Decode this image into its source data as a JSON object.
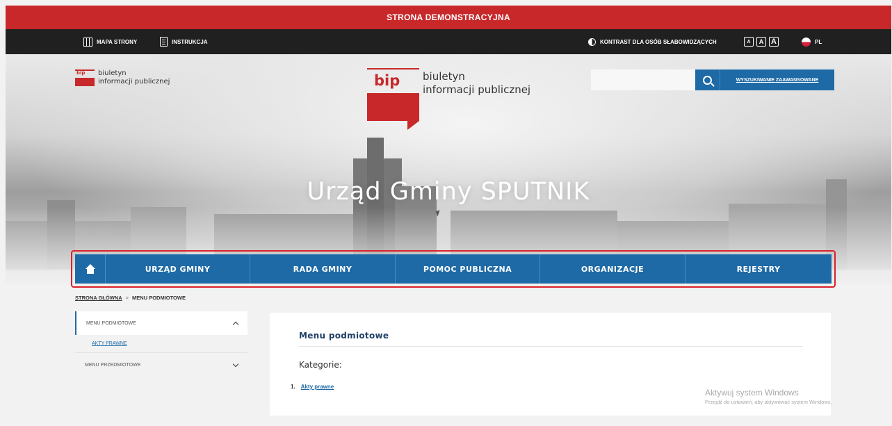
{
  "demo_banner": "STRONA DEMONSTRACYJNA",
  "topbar": {
    "sitemap": "MAPA STRONY",
    "instructions": "INSTRUKCJA",
    "contrast": "KONTRAST DLA OSÓB SŁABOWIDZĄCYCH",
    "font_sizes": [
      "A",
      "A",
      "A"
    ],
    "language": "PL"
  },
  "header": {
    "small_logo_badge": "bip",
    "small_logo_line1": "biuletyn",
    "small_logo_line2": "informacji publicznej",
    "center_logo_badge": "bip",
    "center_logo_line1": "biuletyn",
    "center_logo_line2": "informacji publicznej",
    "search_placeholder": "",
    "advanced_search": "WYSZUKIWANIE ZAAWANSOWANE",
    "hero_title": "Urząd Gminy SPUTNIK"
  },
  "nav": {
    "items": [
      "URZĄD GMINY",
      "RADA GMINY",
      "POMOC PUBLICZNA",
      "ORGANIZACJE",
      "REJESTRY"
    ]
  },
  "breadcrumb": {
    "home": "STRONA GŁÓWNA",
    "separator": ">",
    "current": "MENU PODMIOTOWE"
  },
  "sidebar": {
    "section1": "MENU PODMIOTOWE",
    "section1_sub": "AKTY PRAWNE",
    "section2": "MENU PRZEDMIOTOWE"
  },
  "content": {
    "title": "Menu podmiotowe",
    "categories_label": "Kategorie:",
    "items": [
      {
        "num": "1.",
        "label": "Akty prawne"
      }
    ]
  },
  "watermark": {
    "line1": "Aktywuj system Windows",
    "line2": "Przejdź do ustawień, aby aktywować system Windows."
  },
  "colors": {
    "brand_red": "#c8282a",
    "nav_blue": "#1e6aa6",
    "top_bar": "#202020"
  }
}
